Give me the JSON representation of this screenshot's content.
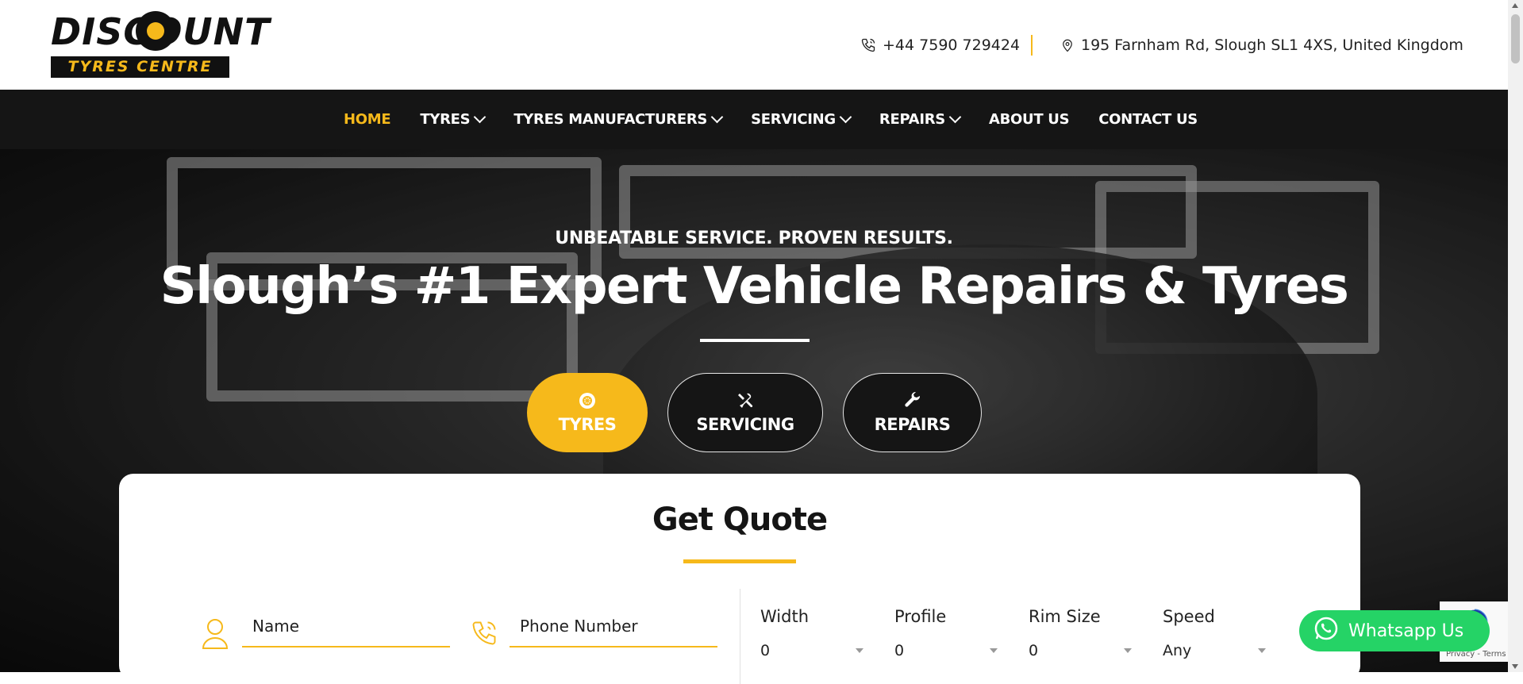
{
  "brand": {
    "logo_word": "DISCOUNT",
    "logo_sub": "TYRES CENTRE",
    "logo_alt": "Discount Tyres Centre logo"
  },
  "header": {
    "phone": "+44 7590 729424",
    "address": "195 Farnham Rd, Slough SL1 4XS, United Kingdom"
  },
  "nav": {
    "items": [
      {
        "label": "HOME",
        "active": true,
        "dropdown": false
      },
      {
        "label": "TYRES",
        "active": false,
        "dropdown": true
      },
      {
        "label": "TYRES MANUFACTURERS",
        "active": false,
        "dropdown": true
      },
      {
        "label": "SERVICING",
        "active": false,
        "dropdown": true
      },
      {
        "label": "REPAIRS",
        "active": false,
        "dropdown": true
      },
      {
        "label": "ABOUT US",
        "active": false,
        "dropdown": false
      },
      {
        "label": "CONTACT US",
        "active": false,
        "dropdown": false
      }
    ]
  },
  "hero": {
    "tagline": "UNBEATABLE SERVICE. PROVEN RESULTS.",
    "headline": "Slough’s #1 Expert Vehicle Repairs & Tyres",
    "services": [
      {
        "label": "TYRES",
        "icon": "tyre-icon",
        "active": true
      },
      {
        "label": "SERVICING",
        "icon": "tools-icon",
        "active": false
      },
      {
        "label": "REPAIRS",
        "icon": "wrench-icon",
        "active": false
      }
    ]
  },
  "quote": {
    "title": "Get Quote",
    "name_placeholder": "Name",
    "phone_placeholder": "Phone Number",
    "selects": [
      {
        "label": "Width",
        "value": "0"
      },
      {
        "label": "Profile",
        "value": "0"
      },
      {
        "label": "Rim Size",
        "value": "0"
      },
      {
        "label": "Speed",
        "value": "Any"
      }
    ]
  },
  "whatsapp": {
    "label": "Whatsapp Us"
  },
  "recaptcha": {
    "text": "Privacy - Terms"
  },
  "colors": {
    "accent": "#f6b91b",
    "nav_bg": "#151515",
    "whatsapp": "#25d366"
  }
}
